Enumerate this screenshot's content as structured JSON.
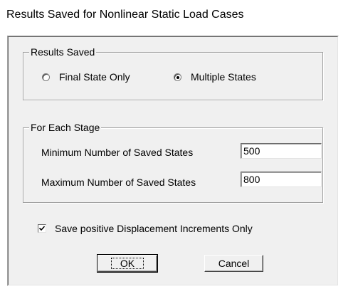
{
  "window": {
    "title": "Results Saved for Nonlinear Static Load Cases"
  },
  "results_saved": {
    "legend": "Results Saved",
    "options": [
      {
        "label": "Final State Only",
        "selected": false
      },
      {
        "label": "Multiple States",
        "selected": true
      }
    ]
  },
  "for_each_stage": {
    "legend": "For Each Stage",
    "min_label": "Minimum Number of Saved States",
    "min_value": "500",
    "max_label": "Maximum Number of Saved States",
    "max_value": "800"
  },
  "save_positive": {
    "label": "Save positive Displacement Increments Only",
    "checked": true
  },
  "buttons": {
    "ok": "OK",
    "cancel": "Cancel"
  }
}
